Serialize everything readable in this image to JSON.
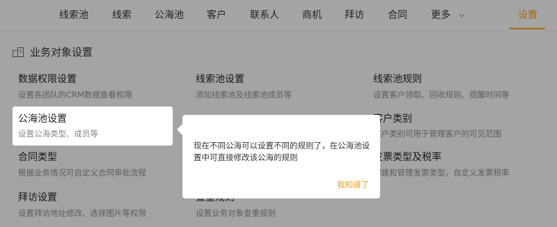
{
  "nav": {
    "items": [
      {
        "label": "线索池"
      },
      {
        "label": "线索"
      },
      {
        "label": "公海池"
      },
      {
        "label": "客户"
      },
      {
        "label": "联系人"
      },
      {
        "label": "商机"
      },
      {
        "label": "拜访"
      },
      {
        "label": "合同"
      }
    ],
    "more_label": "更多",
    "settings_label": "设置",
    "accent_color": "#f39c1a"
  },
  "section": {
    "title": "业务对象设置",
    "icon": "building-icon"
  },
  "items": [
    {
      "title": "数据权限设置",
      "desc": "设置各团队的CRM数据查看权限"
    },
    {
      "title": "线索池设置",
      "desc": "添加线索池及线索池成员等"
    },
    {
      "title": "线索池规则",
      "desc": "设置客户领取、回收规则、提醒时间等"
    },
    {
      "title": "公海池设置",
      "desc": "设置公海类型、成员等"
    },
    {
      "title": "客户类别",
      "desc": "客户类别可用于管理客户的可见范围"
    },
    {
      "title": "合同类型",
      "desc": "根据业务情况可自定义合同审批流程"
    },
    {
      "title": "发票类型及税率",
      "desc": "创建和管理发票类型，自定义发票税率"
    },
    {
      "title": "拜访设置",
      "desc": "设置拜访地址修改、选择图片等权限"
    },
    {
      "title": "查重规则",
      "desc": "设置业务对象查重规则"
    }
  ],
  "tooltip": {
    "text": "现在不同公海可以设置不同的规则了，在公海池设置中可直接修改该公海的规则",
    "button": "我知道了"
  }
}
